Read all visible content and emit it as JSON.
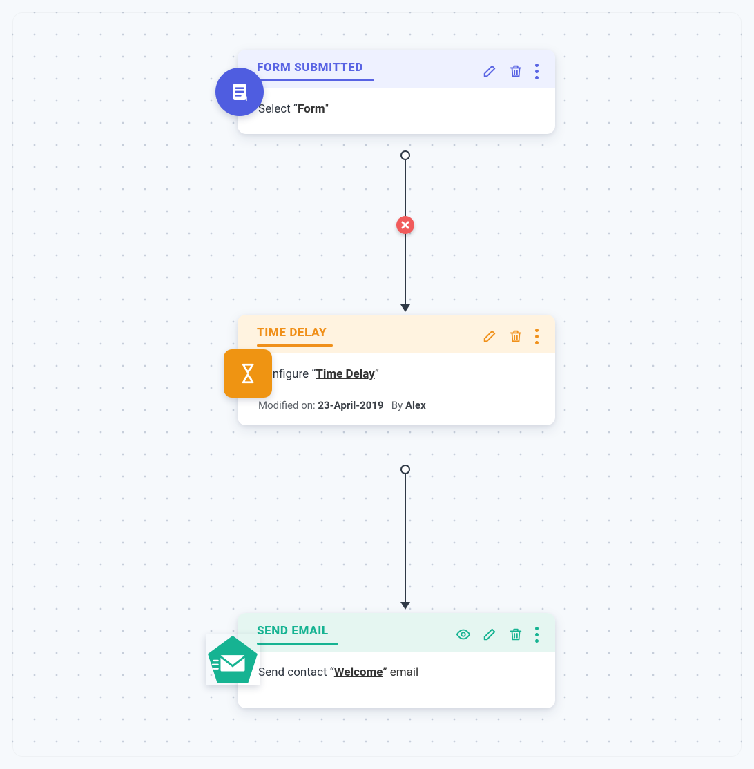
{
  "colors": {
    "form": "#5863e3",
    "delay": "#f0901a",
    "email": "#16b392",
    "remove": "#f15b5b"
  },
  "nodes": {
    "form": {
      "title": "FORM SUBMITTED",
      "body_prefix": "Select “",
      "body_em": "Form",
      "body_suffix": "\""
    },
    "delay": {
      "title": "TIME DELAY",
      "body_prefix": "Configure “",
      "body_em": "Time Delay",
      "body_suffix": "”",
      "modified_label": "Modified on:",
      "modified_date": "23-April-2019",
      "by_label": "By",
      "by_name": "Alex"
    },
    "email": {
      "title": "SEND EMAIL",
      "body_prefix": "Send contact “",
      "body_em": "Welcome",
      "body_suffix": "” email"
    }
  }
}
